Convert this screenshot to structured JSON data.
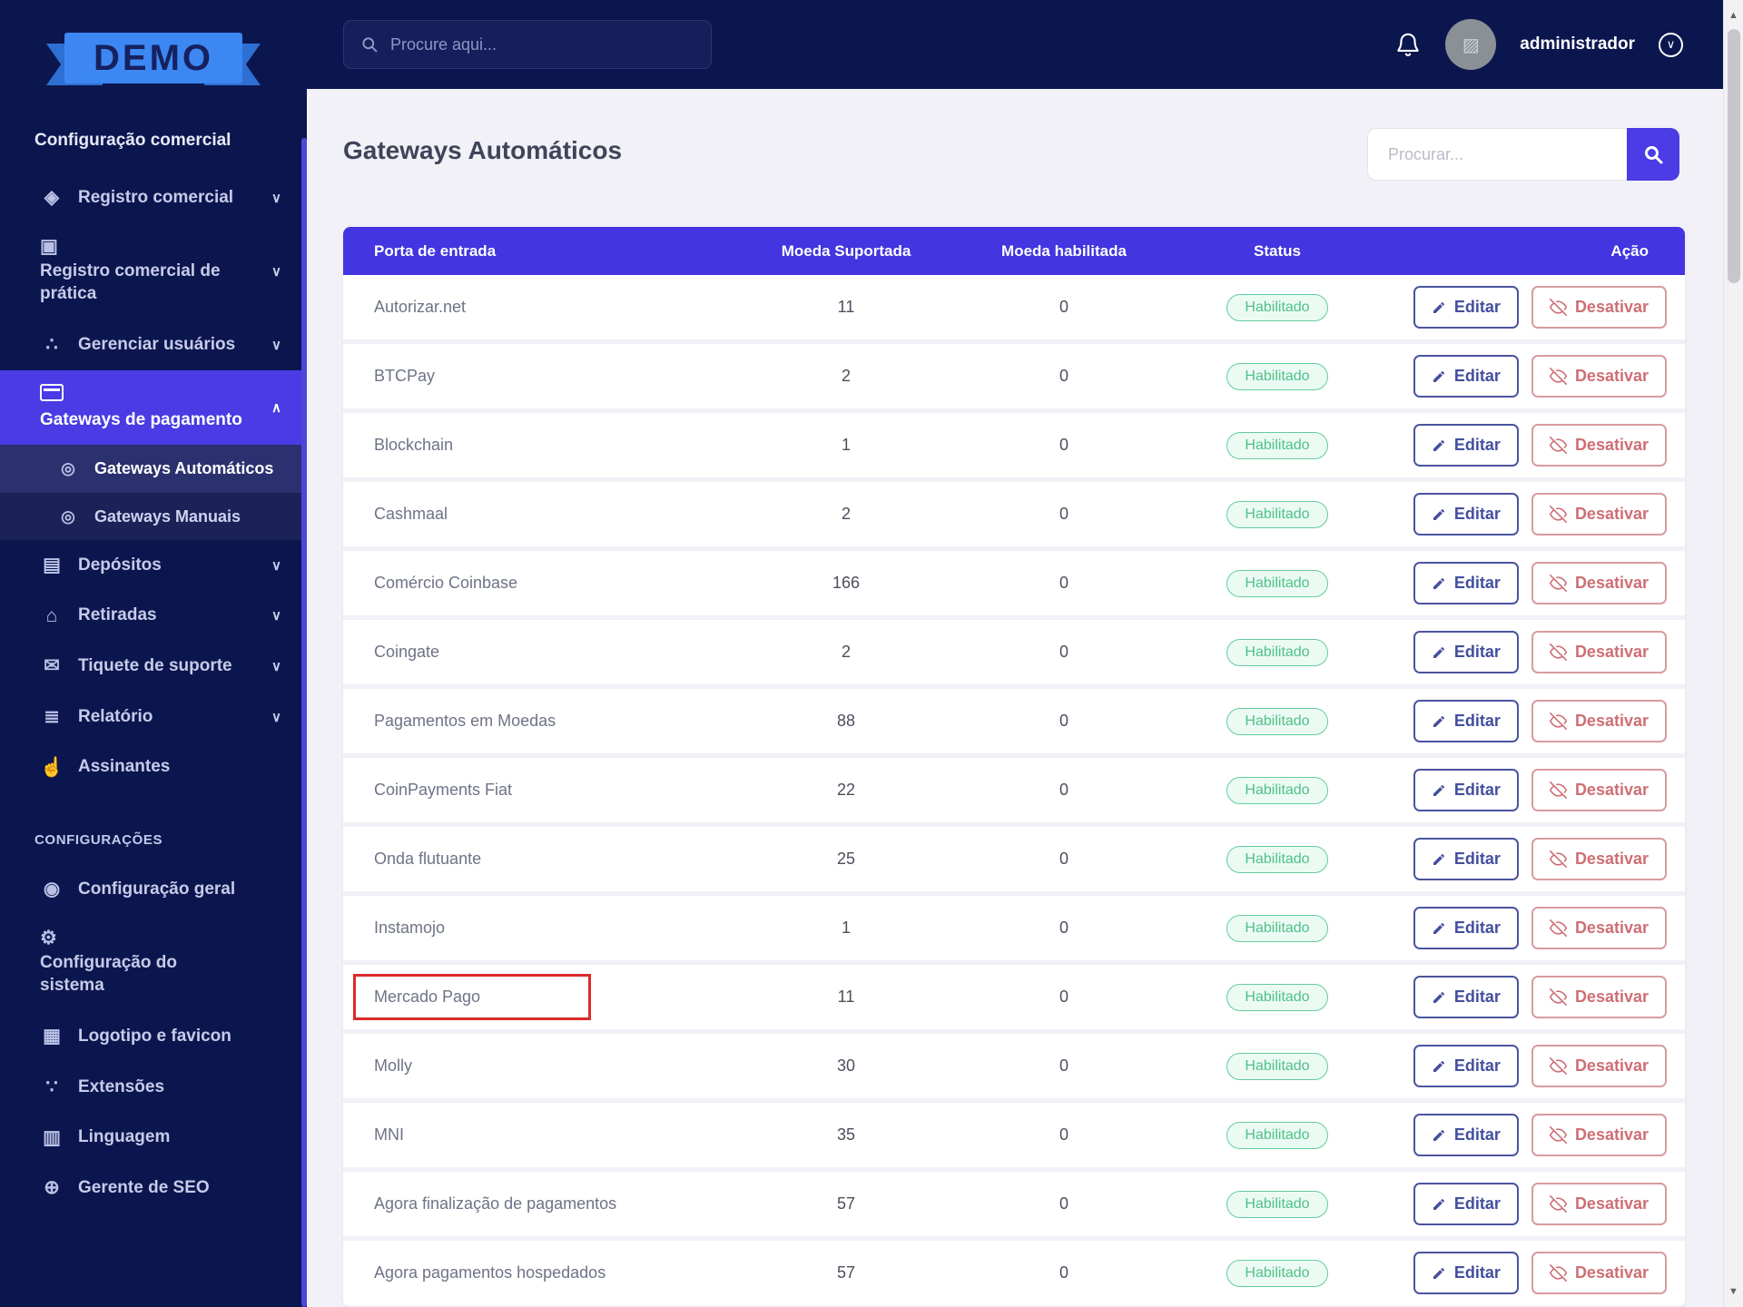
{
  "brand": {
    "logo_text": "DEMO"
  },
  "topbar": {
    "search_placeholder": "Procure aqui...",
    "username": "administrador"
  },
  "sidebar": {
    "items": [
      {
        "type": "section",
        "label": "Configuração comercial"
      },
      {
        "type": "item",
        "label": "Registro comercial",
        "icon": "tags-icon",
        "chevron": "down"
      },
      {
        "type": "item",
        "label": "Registro comercial de prática",
        "icon": "door-icon",
        "chevron": "down",
        "stacked": true
      },
      {
        "type": "item",
        "label": "Gerenciar usuários",
        "icon": "users-icon",
        "chevron": "down"
      },
      {
        "type": "item",
        "label": "Gateways de pagamento",
        "icon": "credit-card-icon",
        "chevron": "up",
        "active": true,
        "stacked": true
      },
      {
        "type": "subitem",
        "label": "Gateways Automáticos",
        "icon": "circle-dot-icon",
        "active": true
      },
      {
        "type": "subitem",
        "label": "Gateways Manuais",
        "icon": "circle-dot-icon"
      },
      {
        "type": "item",
        "label": "Depósitos",
        "icon": "invoice-icon",
        "chevron": "down"
      },
      {
        "type": "item",
        "label": "Retiradas",
        "icon": "bank-icon",
        "chevron": "down"
      },
      {
        "type": "item",
        "label": "Tiquete de suporte",
        "icon": "ticket-icon",
        "chevron": "down"
      },
      {
        "type": "item",
        "label": "Relatório",
        "icon": "list-icon",
        "chevron": "down"
      },
      {
        "type": "item",
        "label": "Assinantes",
        "icon": "thumbs-up-icon"
      },
      {
        "type": "section",
        "label": "CONFIGURAÇÕES",
        "small": true
      },
      {
        "type": "item",
        "label": "Configuração geral",
        "icon": "bullseye-icon"
      },
      {
        "type": "item",
        "label": "Configuração do sistema",
        "icon": "gear-icon",
        "stacked": true
      },
      {
        "type": "item",
        "label": "Logotipo e favicon",
        "icon": "image-icon"
      },
      {
        "type": "item",
        "label": "Extensões",
        "icon": "nodes-icon"
      },
      {
        "type": "item",
        "label": "Linguagem",
        "icon": "language-icon"
      },
      {
        "type": "item",
        "label": "Gerente de SEO",
        "icon": "globe-icon"
      }
    ]
  },
  "page": {
    "title": "Gateways Automáticos",
    "search_placeholder": "Procurar...",
    "table": {
      "headers": [
        "Porta de entrada",
        "Moeda Suportada",
        "Moeda habilitada",
        "Status",
        "Ação"
      ],
      "actions": {
        "edit": "Editar",
        "disable": "Desativar"
      },
      "rows": [
        {
          "name": "Autorizar.net",
          "supported": "11",
          "enabled": "0",
          "status": "Habilitado",
          "highlighted": false
        },
        {
          "name": "BTCPay",
          "supported": "2",
          "enabled": "0",
          "status": "Habilitado",
          "highlighted": false
        },
        {
          "name": "Blockchain",
          "supported": "1",
          "enabled": "0",
          "status": "Habilitado",
          "highlighted": false
        },
        {
          "name": "Cashmaal",
          "supported": "2",
          "enabled": "0",
          "status": "Habilitado",
          "highlighted": false
        },
        {
          "name": "Comércio Coinbase",
          "supported": "166",
          "enabled": "0",
          "status": "Habilitado",
          "highlighted": false
        },
        {
          "name": "Coingate",
          "supported": "2",
          "enabled": "0",
          "status": "Habilitado",
          "highlighted": false
        },
        {
          "name": "Pagamentos em Moedas",
          "supported": "88",
          "enabled": "0",
          "status": "Habilitado",
          "highlighted": false
        },
        {
          "name": "CoinPayments Fiat",
          "supported": "22",
          "enabled": "0",
          "status": "Habilitado",
          "highlighted": false
        },
        {
          "name": "Onda flutuante",
          "supported": "25",
          "enabled": "0",
          "status": "Habilitado",
          "highlighted": false
        },
        {
          "name": "Instamojo",
          "supported": "1",
          "enabled": "0",
          "status": "Habilitado",
          "highlighted": false
        },
        {
          "name": "Mercado Pago",
          "supported": "11",
          "enabled": "0",
          "status": "Habilitado",
          "highlighted": true
        },
        {
          "name": "Molly",
          "supported": "30",
          "enabled": "0",
          "status": "Habilitado",
          "highlighted": false
        },
        {
          "name": "MNI",
          "supported": "35",
          "enabled": "0",
          "status": "Habilitado",
          "highlighted": false
        },
        {
          "name": "Agora finalização de pagamentos",
          "supported": "57",
          "enabled": "0",
          "status": "Habilitado",
          "highlighted": false
        },
        {
          "name": "Agora pagamentos hospedados",
          "supported": "57",
          "enabled": "0",
          "status": "Habilitado",
          "highlighted": false
        }
      ]
    }
  },
  "colors": {
    "navy": "#0c164e",
    "accent_indigo": "#4335df",
    "active_menu_indigo": "#4a3be4",
    "badge_green": "#4fc08a",
    "edit_blue": "#444f9e",
    "danger_red": "#ce6f75",
    "highlight_red": "#da2a2a"
  }
}
